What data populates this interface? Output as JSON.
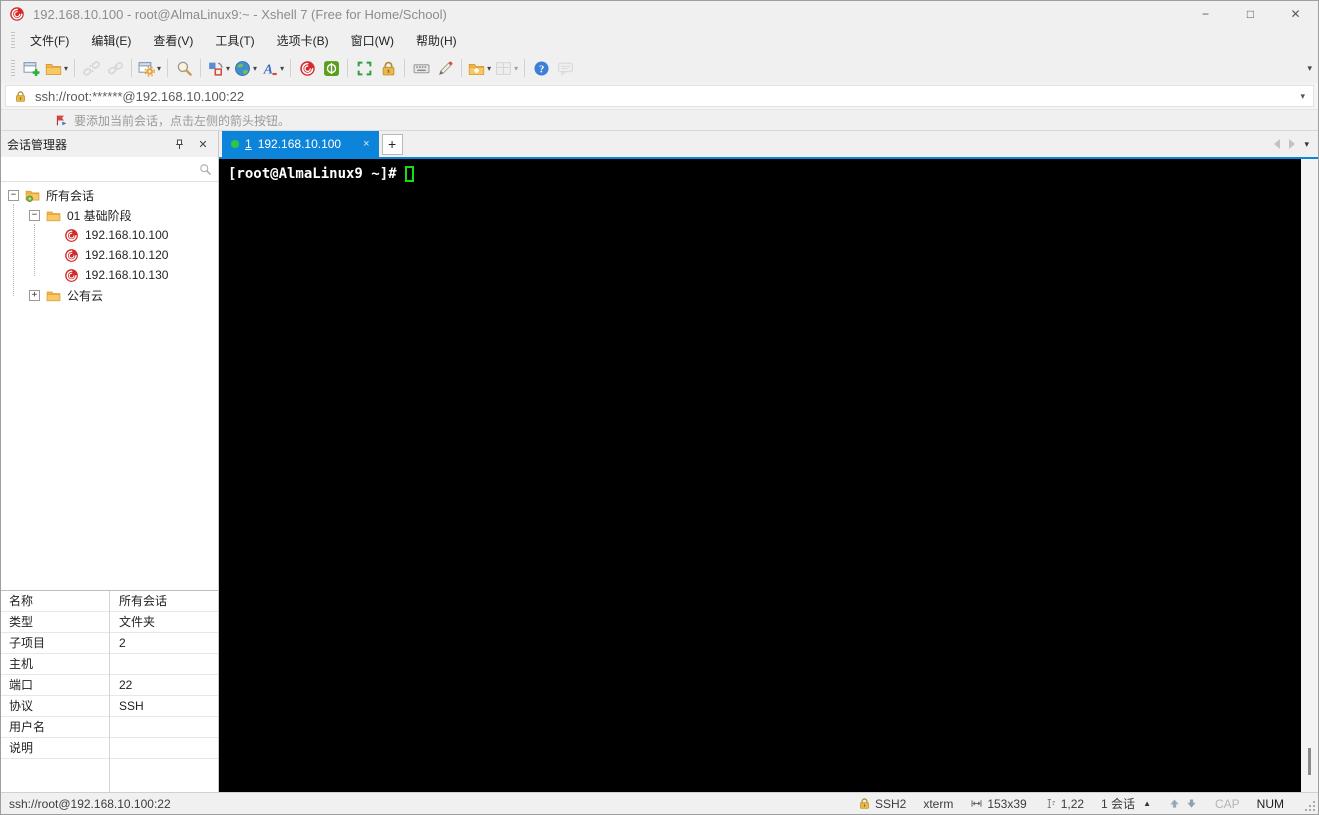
{
  "colors": {
    "accent_blue": "#0c84da",
    "terminal_background": "#000000",
    "terminal_text": "#ffffff",
    "cursor_green": "#17dd17",
    "xshell_red": "#d42a2a",
    "folder_amber": "#f3b64f",
    "tab_dot_green": "#30c83a",
    "chrome_gray": "#f0f0f0"
  },
  "window": {
    "title": "192.168.10.100 - root@AlmaLinux9:~ - Xshell 7 (Free for Home/School)",
    "controls": {
      "minimize": "−",
      "maximize": "□",
      "close": "✕"
    }
  },
  "menu": {
    "items": [
      "文件(F)",
      "编辑(E)",
      "查看(V)",
      "工具(T)",
      "选项卡(B)",
      "窗口(W)",
      "帮助(H)"
    ]
  },
  "toolbar": {
    "icons": [
      "new-session",
      "open-session-folder",
      "disconnect",
      "reconnect",
      "session-properties",
      "find",
      "layout",
      "web-browser",
      "font-color",
      "xshell",
      "xftp",
      "fullscreen",
      "lock-screen",
      "virtual-keyboard",
      "highlight-pen",
      "new-terminal-folder",
      "tile-windows",
      "help",
      "feedback"
    ]
  },
  "address_bar": {
    "value": "ssh://root:******@192.168.10.100:22"
  },
  "notice_bar": {
    "text": "要添加当前会话，点击左侧的箭头按钮。"
  },
  "session_manager": {
    "title": "会话管理器",
    "search_value": "",
    "tree": [
      {
        "label": "所有会话",
        "expander": "−",
        "icon": "sessions-root-folder"
      },
      {
        "label": "01 基础阶段",
        "expander": "−",
        "icon": "folder"
      },
      {
        "label": "192.168.10.100",
        "expander": "",
        "icon": "xshell-session"
      },
      {
        "label": "192.168.10.120",
        "expander": "",
        "icon": "xshell-session"
      },
      {
        "label": "192.168.10.130",
        "expander": "",
        "icon": "xshell-session"
      },
      {
        "label": "公有云",
        "expander": "+",
        "icon": "folder"
      }
    ],
    "properties": [
      {
        "key": "名称",
        "value": "所有会话"
      },
      {
        "key": "类型",
        "value": "文件夹"
      },
      {
        "key": "子项目",
        "value": "2"
      },
      {
        "key": "主机",
        "value": ""
      },
      {
        "key": "端口",
        "value": "22"
      },
      {
        "key": "协议",
        "value": "SSH"
      },
      {
        "key": "用户名",
        "value": ""
      },
      {
        "key": "说明",
        "value": ""
      }
    ]
  },
  "tab_bar": {
    "active_tab": {
      "number": "1",
      "label": "192.168.10.100",
      "close": "×"
    },
    "new_tab": "+"
  },
  "terminal": {
    "prompt": "[root@AlmaLinux9 ~]#"
  },
  "status_bar": {
    "connection": "ssh://root@192.168.10.100:22",
    "protocol": "SSH2",
    "terminal_type": "xterm",
    "screen_size": "153x39",
    "cursor_position": "1,22",
    "session_count": "1 会话",
    "caps_indicator": "CAP",
    "num_indicator": "NUM"
  }
}
